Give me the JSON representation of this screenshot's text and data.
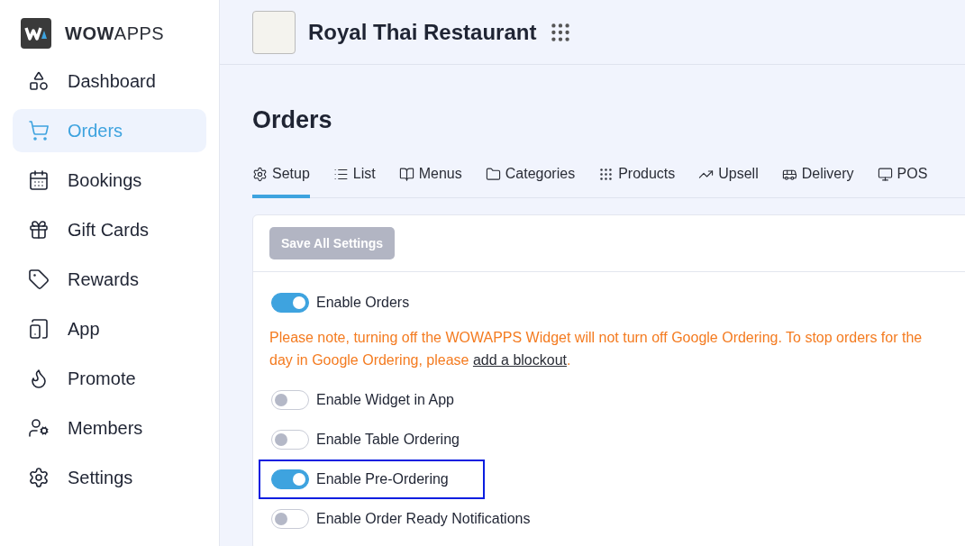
{
  "brand": {
    "name": "**WOW**APPS"
  },
  "sidebar": {
    "items": [
      {
        "label": "Dashboard",
        "selected": false
      },
      {
        "label": "Orders",
        "selected": true
      },
      {
        "label": "Bookings",
        "selected": false
      },
      {
        "label": "Gift Cards",
        "selected": false
      },
      {
        "label": "Rewards",
        "selected": false
      },
      {
        "label": "App",
        "selected": false
      },
      {
        "label": "Promote",
        "selected": false
      },
      {
        "label": "Members",
        "selected": false
      },
      {
        "label": "Settings",
        "selected": false
      }
    ]
  },
  "header": {
    "title": "Royal Thai Restaurant"
  },
  "page": {
    "title": "Orders"
  },
  "tabs": [
    {
      "label": "Setup",
      "selected": true
    },
    {
      "label": "List",
      "selected": false
    },
    {
      "label": "Menus",
      "selected": false
    },
    {
      "label": "Categories",
      "selected": false
    },
    {
      "label": "Products",
      "selected": false
    },
    {
      "label": "Upsell",
      "selected": false
    },
    {
      "label": "Delivery",
      "selected": false
    },
    {
      "label": "POS",
      "selected": false
    }
  ],
  "save_button": {
    "label": "Save All Settings",
    "disabled": true
  },
  "notice": {
    "text": "Please note, turning off the WOWAPPS Widget will not turn off Google Ordering. To stop orders for the day in Google Ordering, please ",
    "link": "add a blockout",
    "after": "."
  },
  "toggles": [
    {
      "label": "Enable Orders",
      "on": true,
      "highlighted": false
    },
    {
      "label": "Enable Widget in App",
      "on": false,
      "highlighted": false
    },
    {
      "label": "Enable Table Ordering",
      "on": false,
      "highlighted": false
    },
    {
      "label": "Enable Pre-Ordering",
      "on": true,
      "highlighted": true
    },
    {
      "label": "Enable Order Ready Notifications",
      "on": false,
      "highlighted": false
    }
  ]
}
